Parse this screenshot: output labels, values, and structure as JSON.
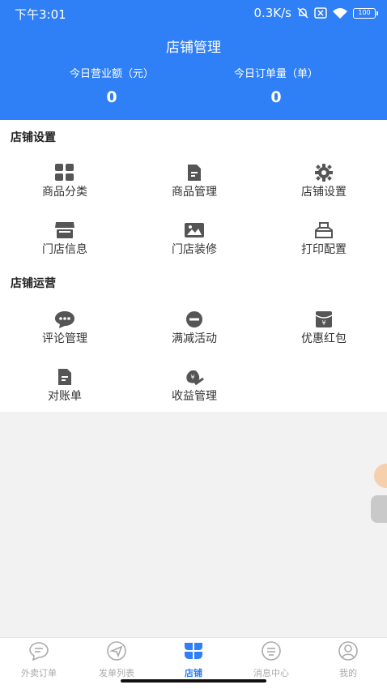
{
  "status_bar": {
    "time": "下午3:01",
    "network_speed": "0.3K/s",
    "battery": "100"
  },
  "header": {
    "title": "店铺管理",
    "stats": [
      {
        "label": "今日营业额（元）",
        "value": "0"
      },
      {
        "label": "今日订单量（单）",
        "value": "0"
      }
    ]
  },
  "store_settings": {
    "title": "店铺设置",
    "items": [
      {
        "label": "商品分类",
        "icon": "grid-icon"
      },
      {
        "label": "商品管理",
        "icon": "document-icon"
      },
      {
        "label": "店铺设置",
        "icon": "gear-icon"
      },
      {
        "label": "门店信息",
        "icon": "storefront-icon"
      },
      {
        "label": "门店装修",
        "icon": "image-icon"
      },
      {
        "label": "打印配置",
        "icon": "printer-icon"
      }
    ]
  },
  "store_operations": {
    "title": "店铺运营",
    "items": [
      {
        "label": "评论管理",
        "icon": "comment-icon"
      },
      {
        "label": "满减活动",
        "icon": "minus-circle-icon"
      },
      {
        "label": "优惠红包",
        "icon": "red-packet-icon"
      },
      {
        "label": "对账单",
        "icon": "statement-icon"
      },
      {
        "label": "收益管理",
        "icon": "money-bag-icon"
      }
    ]
  },
  "tabbar": {
    "tabs": [
      {
        "label": "外卖订单",
        "icon": "order-icon"
      },
      {
        "label": "发单列表",
        "icon": "send-icon"
      },
      {
        "label": "店铺",
        "icon": "store-icon",
        "active": true
      },
      {
        "label": "消息中心",
        "icon": "message-icon"
      },
      {
        "label": "我的",
        "icon": "profile-icon"
      }
    ]
  },
  "colors": {
    "primary": "#2f7ff7",
    "icon_gray": "#555555",
    "tab_inactive": "#aaaaaa"
  }
}
